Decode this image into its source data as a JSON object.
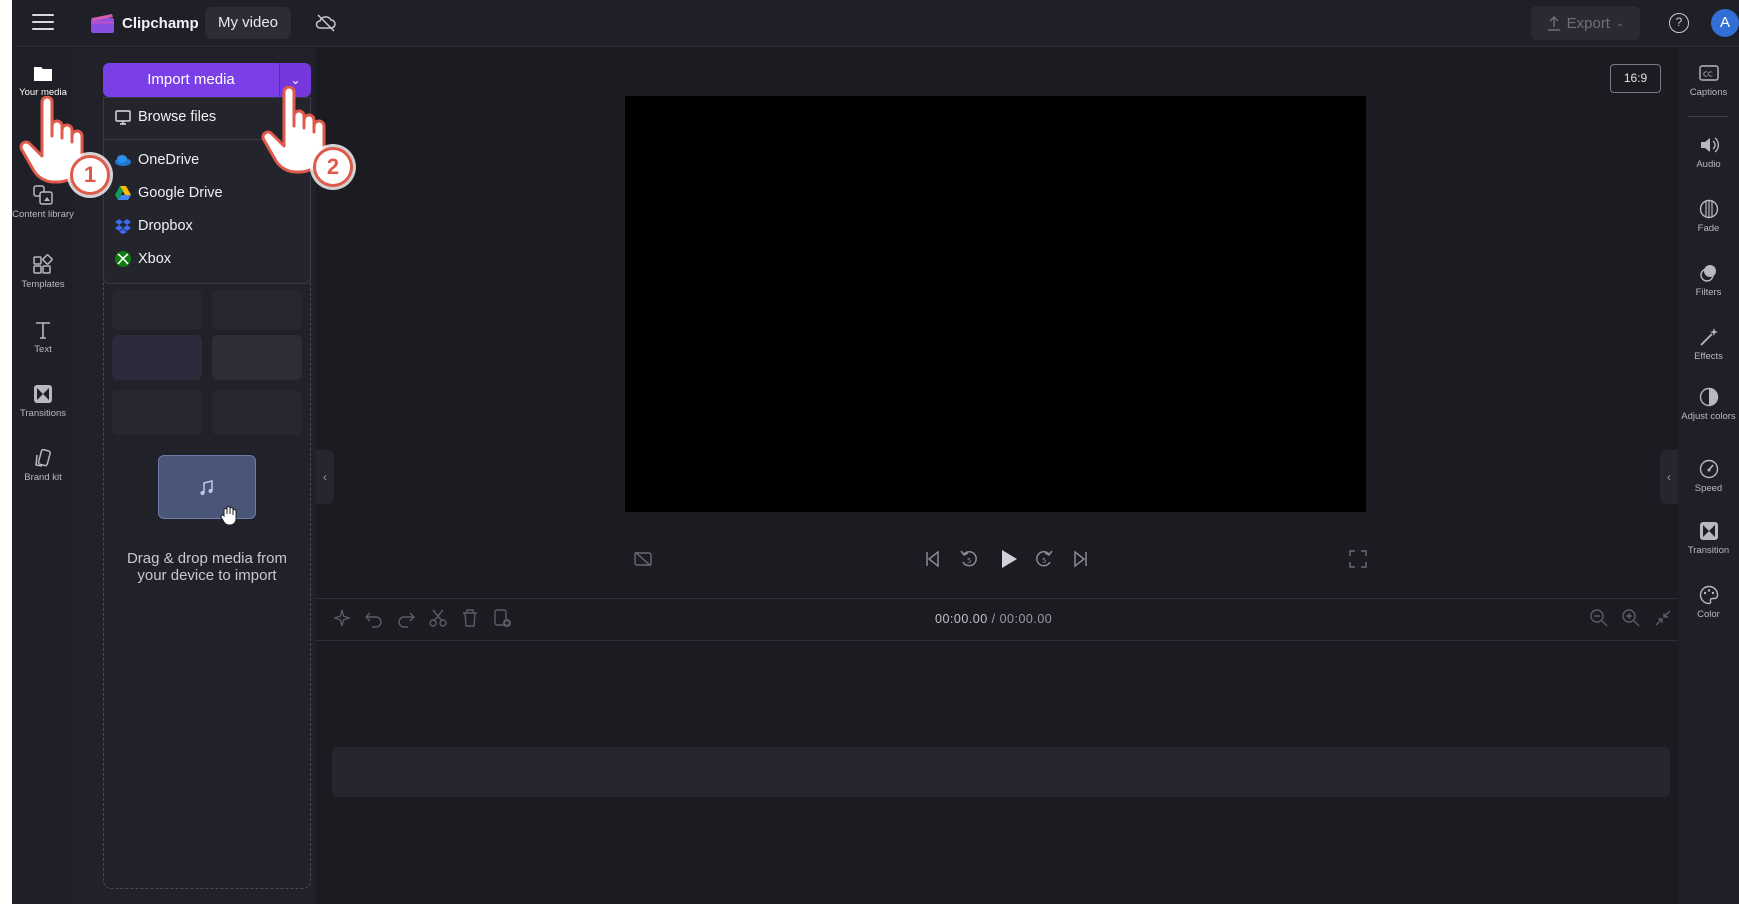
{
  "topbar": {
    "brand": "Clipchamp",
    "video_title": "My video",
    "export_label": "Export",
    "help_symbol": "?",
    "avatar_letter": "A",
    "accent_color": "#7b3fe8"
  },
  "leftnav": {
    "items": [
      {
        "label": "Your media",
        "icon": "folder-icon"
      },
      {
        "label": "Content library",
        "icon": "content-library-icon"
      },
      {
        "label": "Templates",
        "icon": "templates-icon"
      },
      {
        "label": "Text",
        "icon": "text-icon"
      },
      {
        "label": "Transitions",
        "icon": "transitions-icon"
      },
      {
        "label": "Brand kit",
        "icon": "brand-kit-icon"
      }
    ]
  },
  "media_panel": {
    "import_label": "Import media",
    "dropzone_text_1": "Drag & drop media from",
    "dropzone_text_2": "your device to import",
    "dropdown": {
      "items": [
        {
          "label": "Browse files",
          "icon": "monitor-icon"
        },
        {
          "label": "OneDrive",
          "icon": "onedrive-icon"
        },
        {
          "label": "Google Drive",
          "icon": "google-drive-icon"
        },
        {
          "label": "Dropbox",
          "icon": "dropbox-icon"
        },
        {
          "label": "Xbox",
          "icon": "xbox-icon"
        }
      ]
    }
  },
  "preview": {
    "aspect_ratio": "16:9"
  },
  "timeline": {
    "current_time": "00:00.00",
    "separator": " / ",
    "total_time": "00:00.00"
  },
  "rightnav": {
    "items": [
      {
        "label": "Captions",
        "icon": "captions-icon"
      },
      {
        "label": "Audio",
        "icon": "speaker-icon"
      },
      {
        "label": "Fade",
        "icon": "fade-icon"
      },
      {
        "label": "Filters",
        "icon": "filters-icon"
      },
      {
        "label": "Effects",
        "icon": "magic-wand-icon"
      },
      {
        "label": "Adjust colors",
        "icon": "adjust-colors-icon"
      },
      {
        "label": "Speed",
        "icon": "speedometer-icon"
      },
      {
        "label": "Transition",
        "icon": "transition-icon"
      },
      {
        "label": "Color",
        "icon": "palette-icon"
      }
    ]
  },
  "annotations": {
    "step_1": "1",
    "step_2": "2",
    "marker_color": "#e05a4c"
  }
}
